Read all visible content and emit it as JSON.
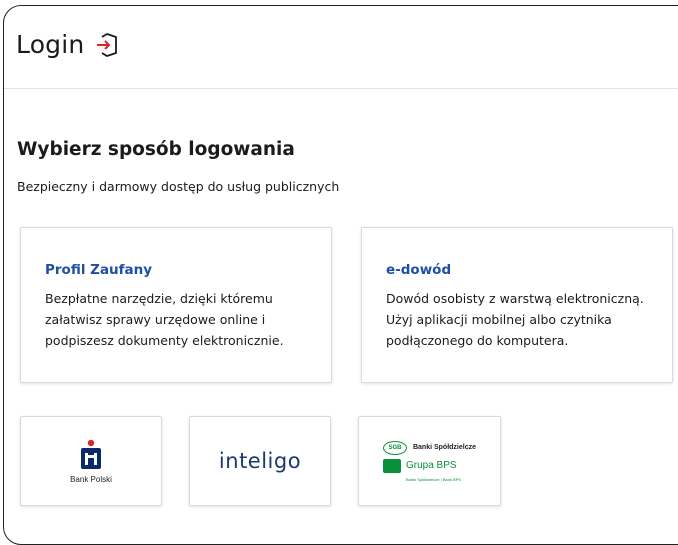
{
  "header": {
    "title": "Login",
    "icon": "login-icon"
  },
  "section": {
    "title": "Wybierz sposób logowania",
    "subtitle": "Bezpieczny i darmowy dostęp do usług publicznych"
  },
  "methods": [
    {
      "title": "Profil Zaufany",
      "description": "Bezpłatne narzędzie, dzięki któremu załatwisz sprawy urzędowe online i podpiszesz dokumenty elektronicznie."
    },
    {
      "title": "e-dowód",
      "description": "Dowód osobisty z warstwą elektroniczną. Użyj aplikacji mobilnej albo czytnika podłączonego do komputera."
    }
  ],
  "banks": [
    {
      "name": "Bank Polski",
      "logo": "pko-logo"
    },
    {
      "name": "inteligo",
      "logo": "inteligo-logo"
    },
    {
      "name": "Grupa BPS",
      "badge": "SGB",
      "line1": "Banki Spółdzielcze",
      "line3": "Banki Spółdzielcze | Bank BPS",
      "logo": "bps-logo"
    }
  ],
  "colors": {
    "accent": "#1f4ea8",
    "text": "#1b1b1b",
    "bps_green": "#0a8f3c",
    "pko_blue": "#0a2a6b",
    "login_icon_red": "#d92626"
  }
}
